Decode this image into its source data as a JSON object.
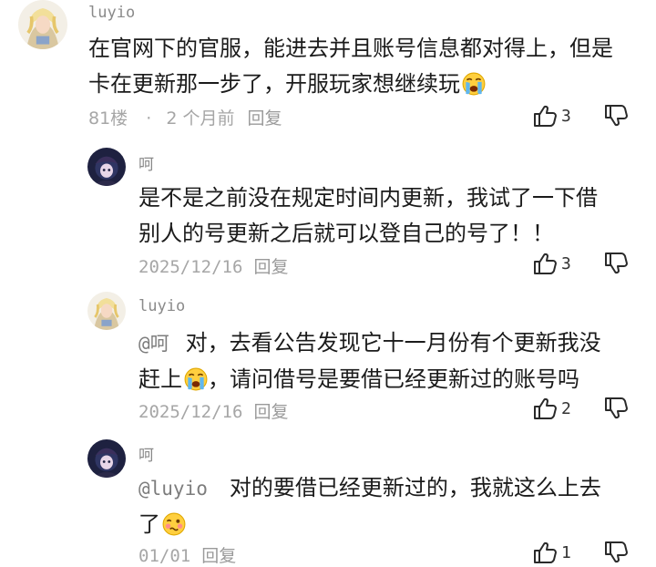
{
  "comments": [
    {
      "user": "luyio",
      "lines": [
        "在官网下的官服，能进去并且账号信息都对得上，但是",
        "卡在更新那一步了，开服玩家想继续玩"
      ],
      "trailing_emoji": "loudly-crying-face",
      "floor": "81楼",
      "separator": "·",
      "time": "2 个月前",
      "reply_label": "回复",
      "likes": "3"
    },
    {
      "user": "呵",
      "lines": [
        "是不是之前没在规定时间内更新，我试了一下借",
        "别人的号更新之后就可以登自己的号了！！"
      ],
      "date": "2025/12/16",
      "reply_label": "回复",
      "likes": "3"
    },
    {
      "user": "luyio",
      "mention": "@呵",
      "line1_rest": "对，去看公告发现它十一月份有个更新我没",
      "line2_pre": "赶上",
      "line2_emoji": "loudly-crying-face",
      "line2_post": "，请问借号是要借已经更新过的账号吗",
      "date": "2025/12/16",
      "reply_label": "回复",
      "likes": "2"
    },
    {
      "user": "呵",
      "mention": "@luyio",
      "line1_rest": "对的要借已经更新过的，我就这么上去",
      "line2_pre": "了",
      "line2_emoji": "woozy-face",
      "date": "01/01",
      "reply_label": "回复",
      "likes": "1"
    }
  ],
  "icons": {
    "like": "thumbs-up-icon",
    "dislike": "thumbs-down-icon"
  }
}
